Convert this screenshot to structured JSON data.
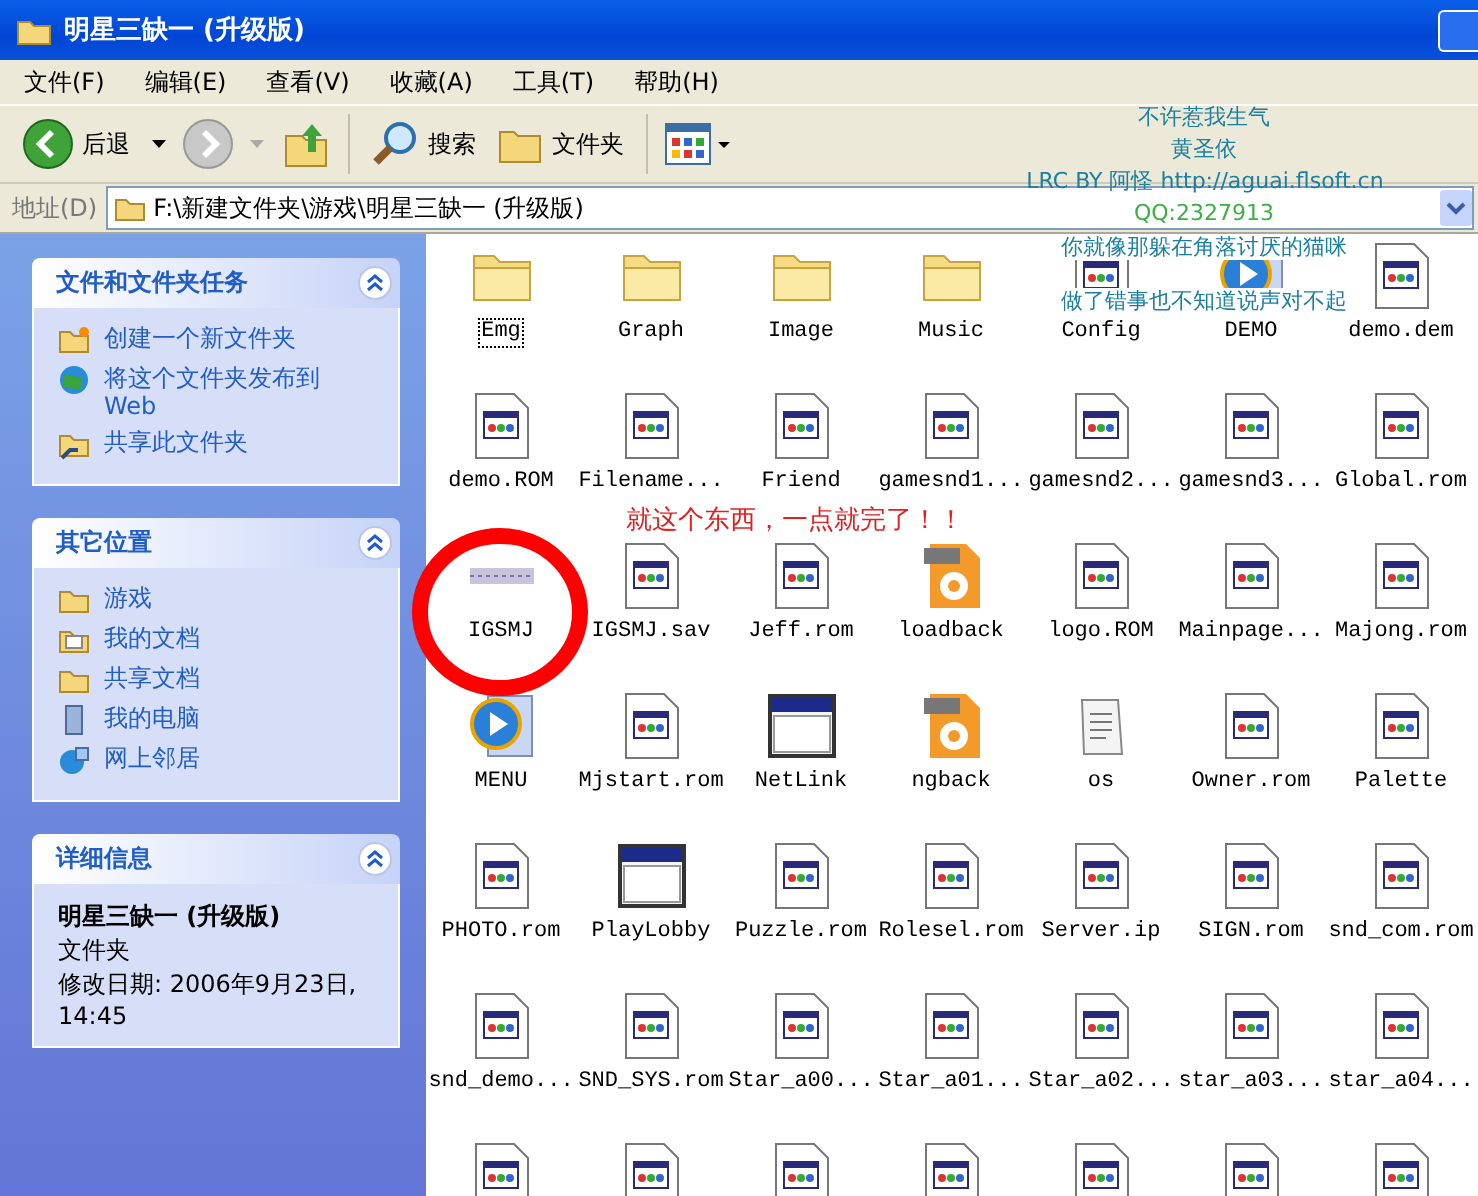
{
  "window": {
    "title": "明星三缺一 (升级版)"
  },
  "menu": [
    "文件(F)",
    "编辑(E)",
    "查看(V)",
    "收藏(A)",
    "工具(T)",
    "帮助(H)"
  ],
  "toolbar": {
    "back": "后退",
    "search": "搜索",
    "folders": "文件夹"
  },
  "address": {
    "label": "地址(D)",
    "value": "F:\\新建文件夹\\游戏\\明星三缺一 (升级版)"
  },
  "sidebar": [
    {
      "title": "文件和文件夹任务",
      "kind": "links",
      "items": [
        {
          "label": "创建一个新文件夹",
          "kind": "new-folder"
        },
        {
          "label": "将这个文件夹发布到 Web",
          "kind": "globe"
        },
        {
          "label": "共享此文件夹",
          "kind": "share"
        }
      ]
    },
    {
      "title": "其它位置",
      "kind": "links",
      "items": [
        {
          "label": "游戏",
          "kind": "folder"
        },
        {
          "label": "我的文档",
          "kind": "documents"
        },
        {
          "label": "共享文档",
          "kind": "folder"
        },
        {
          "label": "我的电脑",
          "kind": "computer"
        },
        {
          "label": "网上邻居",
          "kind": "network"
        }
      ]
    },
    {
      "title": "详细信息",
      "kind": "details",
      "name": "明星三缺一 (升级版)",
      "type": "文件夹",
      "modified": "修改日期: 2006年9月23日, 14:45"
    }
  ],
  "files": [
    {
      "name": "Emg",
      "kind": "folder",
      "focused": true
    },
    {
      "name": "Graph",
      "kind": "folder",
      "focused": false
    },
    {
      "name": "Image",
      "kind": "folder",
      "focused": false
    },
    {
      "name": "Music",
      "kind": "folder",
      "focused": false
    },
    {
      "name": "Config",
      "kind": "doc",
      "focused": false
    },
    {
      "name": "DEMO",
      "kind": "media",
      "focused": false
    },
    {
      "name": "demo.dem",
      "kind": "doc",
      "focused": false
    },
    {
      "name": "demo.ROM",
      "kind": "doc",
      "focused": false
    },
    {
      "name": "Filename...",
      "kind": "doc",
      "focused": false
    },
    {
      "name": "Friend",
      "kind": "doc",
      "focused": false
    },
    {
      "name": "gamesnd1...",
      "kind": "doc",
      "focused": false
    },
    {
      "name": "gamesnd2...",
      "kind": "doc",
      "focused": false
    },
    {
      "name": "gamesnd3...",
      "kind": "doc",
      "focused": false
    },
    {
      "name": "Global.rom",
      "kind": "doc",
      "focused": false
    },
    {
      "name": "IGSMJ",
      "kind": "thumb",
      "focused": false
    },
    {
      "name": "IGSMJ.sav",
      "kind": "doc",
      "focused": false
    },
    {
      "name": "Jeff.rom",
      "kind": "doc",
      "focused": false
    },
    {
      "name": "loadback",
      "kind": "pcx",
      "focused": false
    },
    {
      "name": "logo.ROM",
      "kind": "doc",
      "focused": false
    },
    {
      "name": "Mainpage...",
      "kind": "doc",
      "focused": false
    },
    {
      "name": "Majong.rom",
      "kind": "doc",
      "focused": false
    },
    {
      "name": "MENU",
      "kind": "media",
      "focused": false
    },
    {
      "name": "Mjstart.rom",
      "kind": "doc",
      "focused": false
    },
    {
      "name": "NetLink",
      "kind": "app",
      "focused": false
    },
    {
      "name": "ngback",
      "kind": "pcx",
      "focused": false
    },
    {
      "name": "os",
      "kind": "notepad",
      "focused": false
    },
    {
      "name": "Owner.rom",
      "kind": "doc",
      "focused": false
    },
    {
      "name": "Palette",
      "kind": "doc",
      "focused": false
    },
    {
      "name": "PHOTO.rom",
      "kind": "doc",
      "focused": false
    },
    {
      "name": "PlayLobby",
      "kind": "app",
      "focused": false
    },
    {
      "name": "Puzzle.rom",
      "kind": "doc",
      "focused": false
    },
    {
      "name": "Rolesel.rom",
      "kind": "doc",
      "focused": false
    },
    {
      "name": "Server.ip",
      "kind": "doc",
      "focused": false
    },
    {
      "name": "SIGN.rom",
      "kind": "doc",
      "focused": false
    },
    {
      "name": "snd_com.rom",
      "kind": "doc",
      "focused": false
    },
    {
      "name": "snd_demo...",
      "kind": "doc",
      "focused": false
    },
    {
      "name": "SND_SYS.rom",
      "kind": "doc",
      "focused": false
    },
    {
      "name": "Star_a00...",
      "kind": "doc",
      "focused": false
    },
    {
      "name": "Star_a01...",
      "kind": "doc",
      "focused": false
    },
    {
      "name": "Star_a02...",
      "kind": "doc",
      "focused": false
    },
    {
      "name": "star_a03...",
      "kind": "doc",
      "focused": false
    },
    {
      "name": "star_a04...",
      "kind": "doc",
      "focused": false
    },
    {
      "kind": "doc"
    },
    {
      "kind": "doc"
    },
    {
      "kind": "doc"
    },
    {
      "kind": "doc"
    },
    {
      "kind": "doc"
    },
    {
      "kind": "doc"
    },
    {
      "kind": "doc"
    }
  ],
  "lyrics": [
    {
      "text": "不许惹我生气",
      "color": "#1a7fa0"
    },
    {
      "text": "黄圣依",
      "color": "#1a7fa0"
    },
    {
      "text": "LRC BY 阿怪 http://aguai.flsoft.cn",
      "color": "#1a7fa0"
    },
    {
      "text": "QQ:2327913",
      "color": "#3cb043"
    },
    {
      "text": "你就像那躲在角落讨厌的猫咪",
      "color": "#1a7fa0"
    },
    {
      "text": "做了错事也不知道说声对不起",
      "color": "#1a7fa0"
    }
  ],
  "annotation": {
    "text": "就这个东西，一点就完了！！"
  }
}
